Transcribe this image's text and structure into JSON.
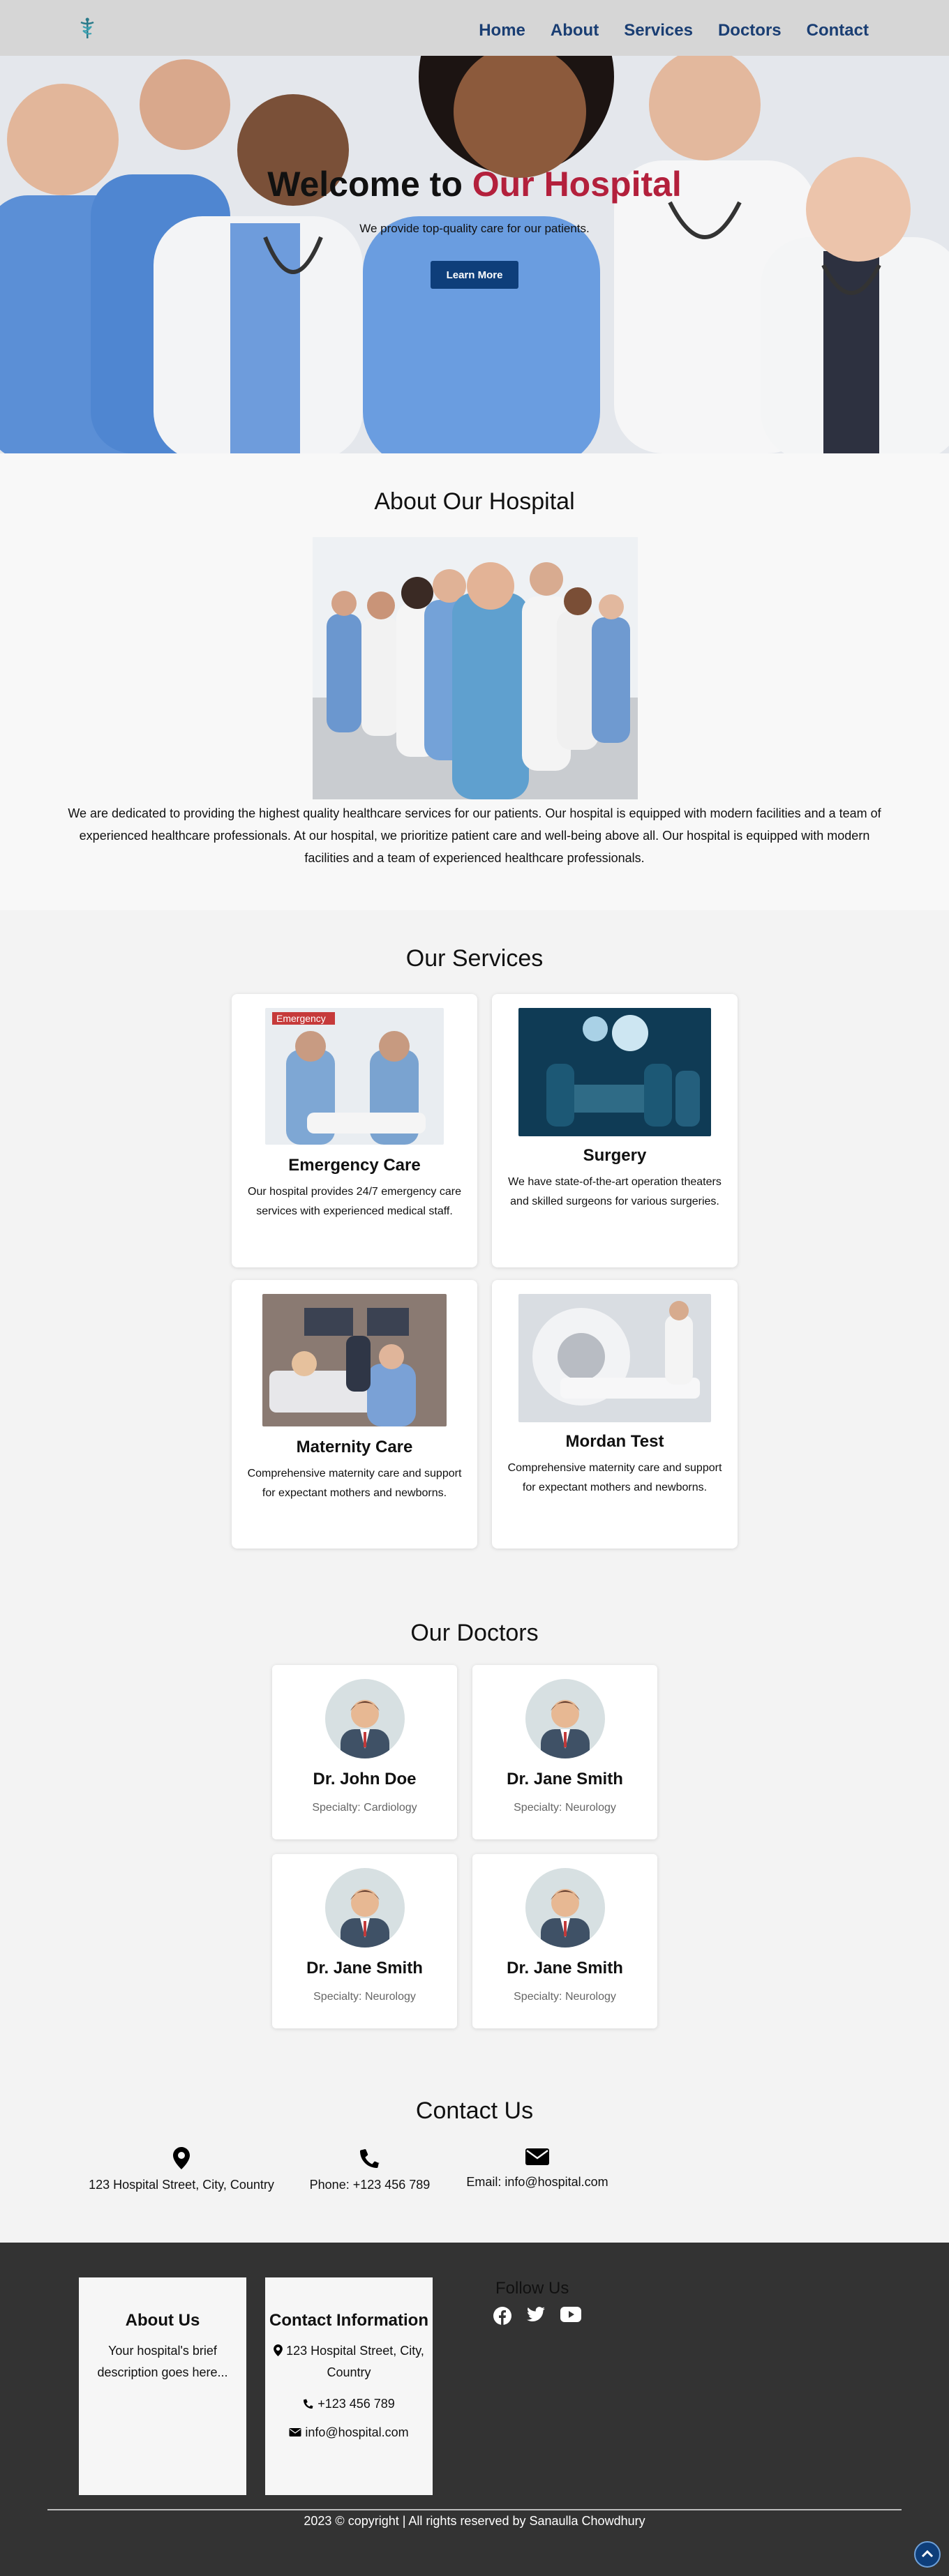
{
  "nav": {
    "logo_icon": "caduceus-icon",
    "links": [
      "Home",
      "About",
      "Services",
      "Doctors",
      "Contact"
    ]
  },
  "hero": {
    "title_prefix": "Welcome to ",
    "title_accent": "Our Hospital",
    "subtitle": "We provide top-quality care for our patients.",
    "button": "Learn More",
    "accent_color": "#b3203c"
  },
  "about": {
    "title": "About Our Hospital",
    "text": "We are dedicated to providing the highest quality healthcare services for our patients. Our hospital is equipped with modern facilities and a team of experienced healthcare professionals. At our hospital, we prioritize patient care and well-being above all. Our hospital is equipped with modern facilities and a team of experienced healthcare professionals."
  },
  "services": {
    "title": "Our Services",
    "items": [
      {
        "title": "Emergency Care",
        "desc": "Our hospital provides 24/7 emergency care services with experienced medical staff.",
        "sign": "Emergency"
      },
      {
        "title": "Surgery",
        "desc": "We have state-of-the-art operation theaters and skilled surgeons for various surgeries."
      },
      {
        "title": "Maternity Care",
        "desc": "Comprehensive maternity care and support for expectant mothers and newborns."
      },
      {
        "title": "Mordan Test",
        "desc": "Comprehensive maternity care and support for expectant mothers and newborns."
      }
    ]
  },
  "doctors": {
    "title": "Our Doctors",
    "items": [
      {
        "name": "Dr. John Doe",
        "specialty": "Specialty: Cardiology"
      },
      {
        "name": "Dr. Jane Smith",
        "specialty": "Specialty: Neurology"
      },
      {
        "name": "Dr. Jane Smith",
        "specialty": "Specialty: Neurology"
      },
      {
        "name": "Dr. Jane Smith",
        "specialty": "Specialty: Neurology"
      }
    ]
  },
  "contact": {
    "title": "Contact Us",
    "address": "123 Hospital Street, City, Country",
    "phone": "Phone: +123 456 789",
    "email": "Email: info@hospital.com"
  },
  "footer": {
    "about_title": "About Us",
    "about_text": "Your hospital's brief description goes here...",
    "contact_title": "Contact Information",
    "contact_address": "123 Hospital Street, City, Country",
    "contact_phone": "+123 456 789",
    "contact_email": "info@hospital.com",
    "follow_title": "Follow Us",
    "social_icons": [
      "facebook-icon",
      "twitter-icon",
      "youtube-icon"
    ],
    "copyright": "2023 © copyright | All rights reserved by Sanaulla Chowdhury",
    "background": "#333333"
  }
}
